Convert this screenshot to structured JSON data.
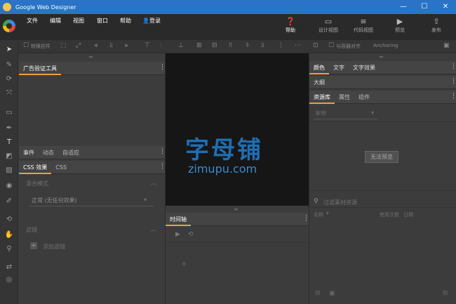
{
  "window": {
    "title": "Google Web Designer",
    "minimize": "—",
    "maximize": "☐",
    "close": "✕"
  },
  "menu": {
    "file": "文件",
    "edit": "编辑",
    "view": "视图",
    "window": "窗口",
    "help": "帮助",
    "login": "登录"
  },
  "ribbon": {
    "help": "帮助",
    "design_view": "设计视图",
    "code_view": "代码视图",
    "preview": "预览",
    "publish": "发布"
  },
  "toolstrip": {
    "convert_control": "转换控件",
    "align_to_container": "与容器对齐",
    "anchoring": "Anchoring"
  },
  "left_panel": {
    "top_tab": "广告验证工具",
    "event_tabs": [
      "事件",
      "动态",
      "自适应"
    ],
    "css_tabs": [
      "CSS 效果",
      "CSS"
    ],
    "blend_mode_label": "混合模式",
    "blend_mode_value": "正常 (无任何效果)",
    "filter_label": "滤镜",
    "add_filter": "添加滤镜"
  },
  "right_panel": {
    "color_tabs": [
      "颜色",
      "文字",
      "文字效果"
    ],
    "outline_label": "大纲",
    "library_tabs": [
      "资源库",
      "属性",
      "组件"
    ],
    "local_label": "本地",
    "no_preview": "无法预览",
    "search_placeholder": "过滤素材资源",
    "columns": [
      "名称",
      "使用次数",
      "日期"
    ]
  },
  "timeline": {
    "label": "时间轴"
  },
  "watermark": {
    "line1": "字母铺",
    "line2": "zimupu.com"
  },
  "colors": {
    "titlebar": "#2a73c6",
    "accent": "#e8a23a",
    "stage": "#161616"
  }
}
